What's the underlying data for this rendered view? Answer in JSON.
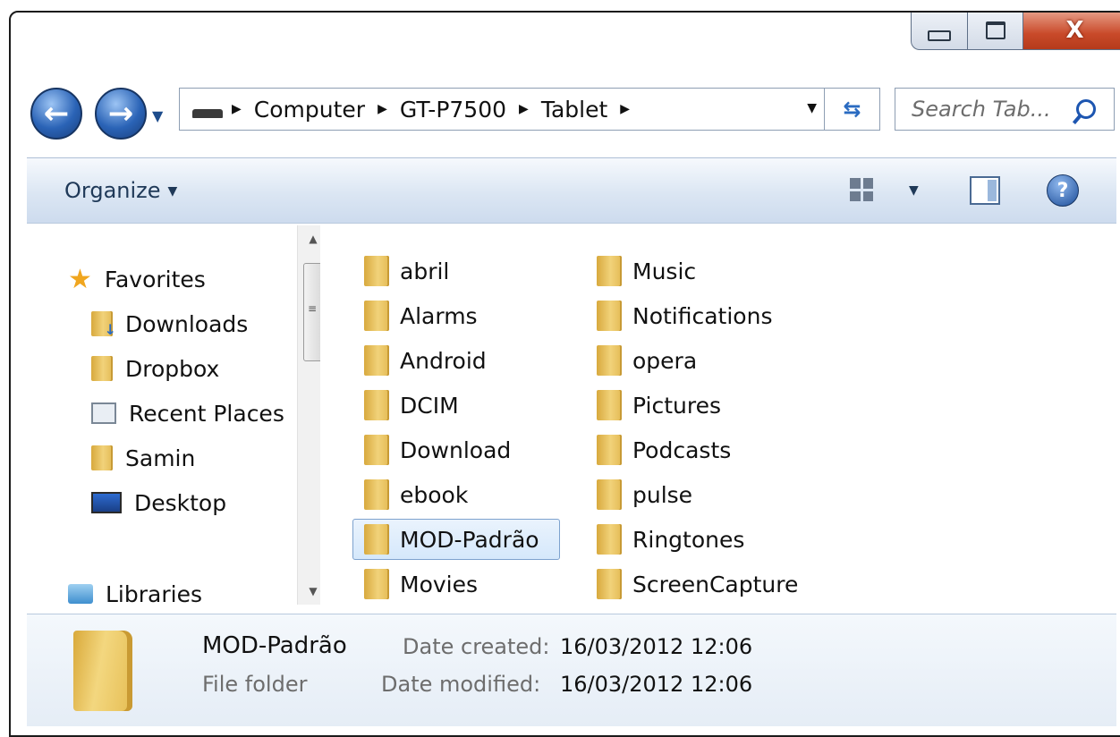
{
  "window": {
    "caption": {
      "close_label": "X"
    }
  },
  "address": {
    "crumbs": [
      "Computer",
      "GT-P7500",
      "Tablet"
    ]
  },
  "search": {
    "placeholder": "Search Tab..."
  },
  "toolbar": {
    "organize_label": "Organize"
  },
  "nav": {
    "favorites": "Favorites",
    "items": [
      {
        "label": "Downloads",
        "icon": "downloads-folder-icon"
      },
      {
        "label": "Dropbox",
        "icon": "dropbox-folder-icon"
      },
      {
        "label": "Recent Places",
        "icon": "recent-places-icon"
      },
      {
        "label": "Samin",
        "icon": "user-folder-icon"
      },
      {
        "label": "Desktop",
        "icon": "desktop-icon"
      }
    ],
    "libraries": "Libraries"
  },
  "content": {
    "folders": [
      "abril",
      "Alarms",
      "Android",
      "DCIM",
      "Download",
      "ebook",
      "MOD-Padrão",
      "Movies",
      "Music",
      "Notifications",
      "opera",
      "Pictures",
      "Podcasts",
      "pulse",
      "Ringtones",
      "ScreenCapture"
    ],
    "selected": "MOD-Padrão"
  },
  "details": {
    "name": "MOD-Padrão",
    "type": "File folder",
    "created_label": "Date created:",
    "created_value": "16/03/2012 12:06",
    "modified_label": "Date modified:",
    "modified_value": "16/03/2012 12:06"
  },
  "colors": {
    "accent": "#2a63b6",
    "selection": "#d5e8fb",
    "close": "#c94a2a"
  }
}
